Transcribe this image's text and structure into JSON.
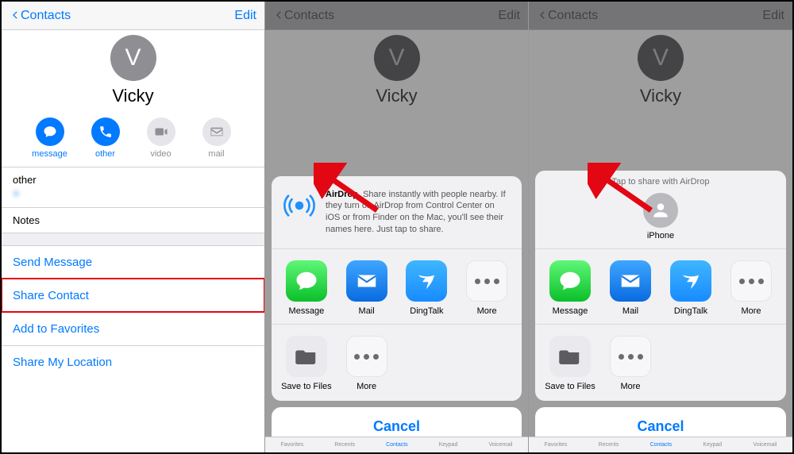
{
  "common": {
    "back_label": "Contacts",
    "edit_label": "Edit",
    "contact_name": "Vicky",
    "contact_initial": "V"
  },
  "panel1": {
    "actions": {
      "message": "message",
      "other": "other",
      "video": "video",
      "mail": "mail"
    },
    "phone_label": "other",
    "phone_number": "+",
    "notes_label": "Notes",
    "links": {
      "send_message": "Send Message",
      "share_contact": "Share Contact",
      "add_favorites": "Add to Favorites",
      "share_location": "Share My Location"
    }
  },
  "share_sheet": {
    "airdrop_title": "AirDrop",
    "airdrop_body": ". Share instantly with people nearby. If they turn on AirDrop from Control Center on iOS or from Finder on the Mac, you'll see their names here. Just tap to share.",
    "tap_title": "Tap to share with AirDrop",
    "recipient_name": "iPhone",
    "apps": {
      "message": "Message",
      "mail": "Mail",
      "dingtalk": "DingTalk",
      "more": "More",
      "save_files": "Save to Files"
    },
    "cancel": "Cancel"
  },
  "tabbar": {
    "favorites": "Favorites",
    "recents": "Recents",
    "contacts": "Contacts",
    "keypad": "Keypad",
    "voicemail": "Voicemail"
  }
}
